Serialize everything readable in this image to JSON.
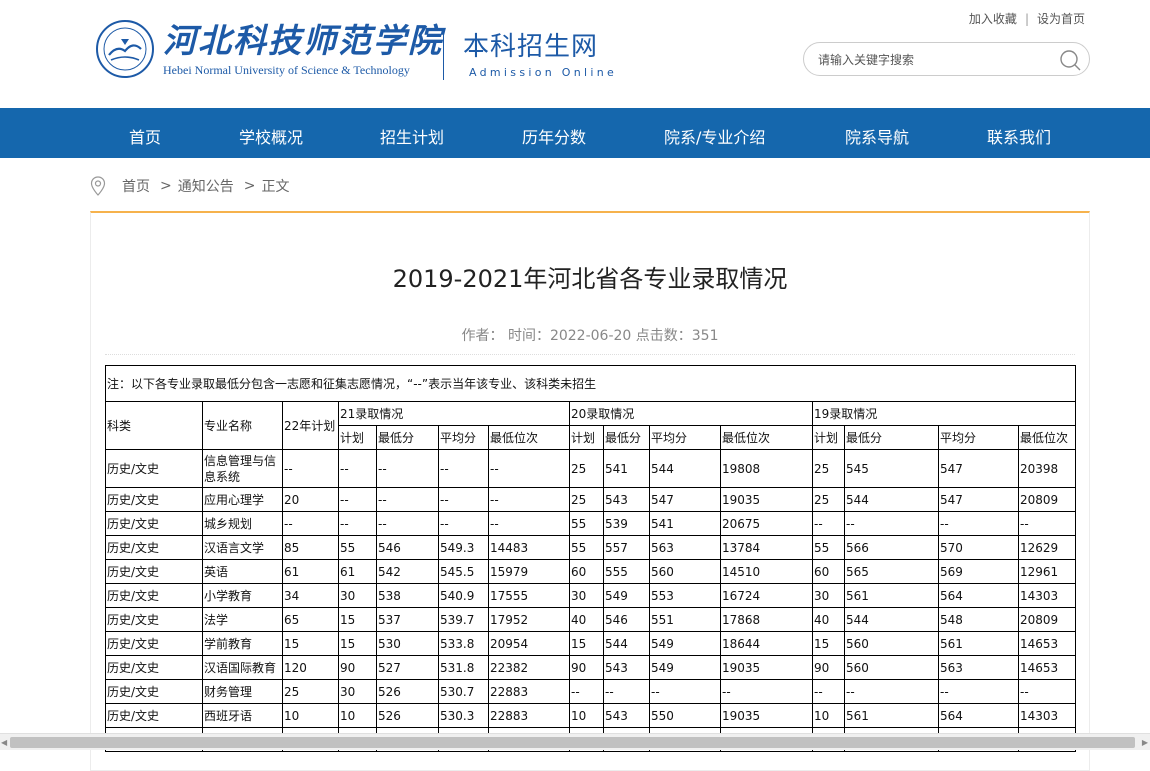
{
  "header": {
    "logo_cn": "河北科技师范学院",
    "logo_en": "Hebei Normal University of Science & Technology",
    "site_cn": "本科招生网",
    "site_en": "Admission Online",
    "links": {
      "bookmark": "加入收藏",
      "homepage": "设为首页"
    },
    "search_placeholder": "请输入关键字搜索"
  },
  "nav": [
    "首页",
    "学校概况",
    "招生计划",
    "历年分数",
    "院系/专业介绍",
    "院系导航",
    "联系我们"
  ],
  "breadcrumb": {
    "home": "首页",
    "section": "通知公告",
    "current": "正文",
    "sep": ">"
  },
  "article": {
    "title": "2019-2021年河北省各专业录取情况",
    "meta": "作者： 时间：2022-06-20 点击数：351"
  },
  "table": {
    "note": "注：以下各专业录取最低分包含一志愿和征集志愿情况，“--”表示当年该专业、该科类未招生",
    "head1": {
      "category": "科类",
      "major": "专业名称",
      "plan22": "22年计划",
      "y21": "21录取情况",
      "y20": "20录取情况",
      "y19": "19录取情况"
    },
    "head2": [
      "计划",
      "最低分",
      "平均分",
      "最低位次"
    ],
    "rows": [
      [
        "历史/文史",
        "信息管理与信息系统",
        "--",
        "--",
        "--",
        "--",
        "--",
        "25",
        "541",
        "544",
        "19808",
        "25",
        "545",
        "547",
        "20398"
      ],
      [
        "历史/文史",
        "应用心理学",
        "20",
        "--",
        "--",
        "--",
        "--",
        "25",
        "543",
        "547",
        "19035",
        "25",
        "544",
        "547",
        "20809"
      ],
      [
        "历史/文史",
        "城乡规划",
        "--",
        "--",
        "--",
        "--",
        "--",
        "55",
        "539",
        "541",
        "20675",
        "--",
        "--",
        "--",
        "--"
      ],
      [
        "历史/文史",
        "汉语言文学",
        "85",
        "55",
        "546",
        "549.3",
        "14483",
        "55",
        "557",
        "563",
        "13784",
        "55",
        "566",
        "570",
        "12629"
      ],
      [
        "历史/文史",
        "英语",
        "61",
        "61",
        "542",
        "545.5",
        "15979",
        "60",
        "555",
        "560",
        "14510",
        "60",
        "565",
        "569",
        "12961"
      ],
      [
        "历史/文史",
        "小学教育",
        "34",
        "30",
        "538",
        "540.9",
        "17555",
        "30",
        "549",
        "553",
        "16724",
        "30",
        "561",
        "564",
        "14303"
      ],
      [
        "历史/文史",
        "法学",
        "65",
        "15",
        "537",
        "539.7",
        "17952",
        "40",
        "546",
        "551",
        "17868",
        "40",
        "544",
        "548",
        "20809"
      ],
      [
        "历史/文史",
        "学前教育",
        "15",
        "15",
        "530",
        "533.8",
        "20954",
        "15",
        "544",
        "549",
        "18644",
        "15",
        "560",
        "561",
        "14653"
      ],
      [
        "历史/文史",
        "汉语国际教育",
        "120",
        "90",
        "527",
        "531.8",
        "22382",
        "90",
        "543",
        "549",
        "19035",
        "90",
        "560",
        "563",
        "14653"
      ],
      [
        "历史/文史",
        "财务管理",
        "25",
        "30",
        "526",
        "530.7",
        "22883",
        "--",
        "--",
        "--",
        "--",
        "--",
        "--",
        "--",
        "--"
      ],
      [
        "历史/文史",
        "西班牙语",
        "10",
        "10",
        "526",
        "530.3",
        "22883",
        "10",
        "543",
        "550",
        "19035",
        "10",
        "561",
        "564",
        "14303"
      ],
      [
        "",
        "",
        "",
        "",
        "",
        "",
        "",
        "",
        "",
        "",
        "",
        "",
        "",
        "",
        ""
      ]
    ]
  },
  "colors": {
    "brand_blue": "#1567ad",
    "accent_orange": "#f6b24c"
  }
}
